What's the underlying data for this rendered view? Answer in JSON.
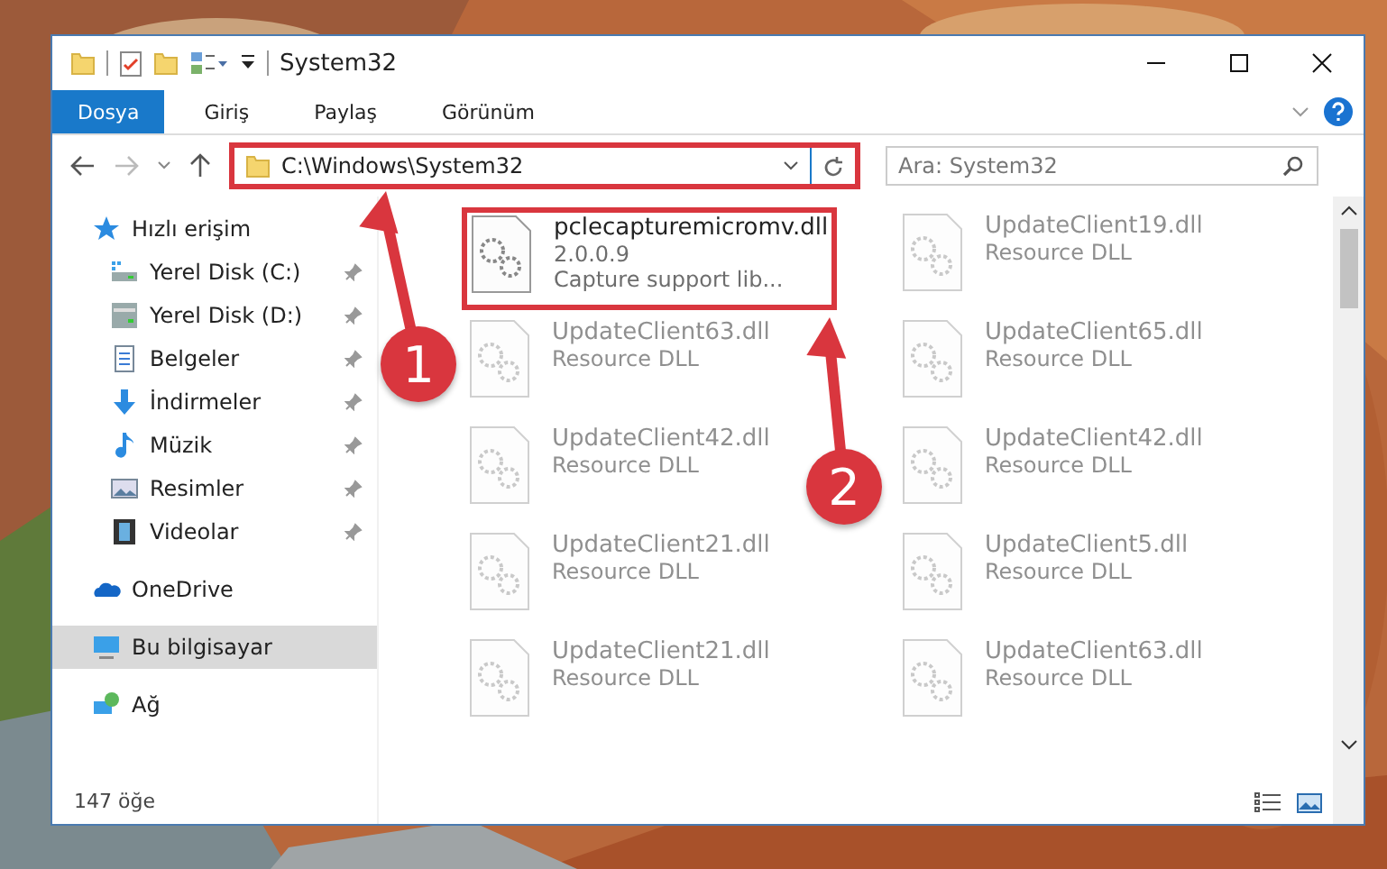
{
  "window": {
    "title": "System32"
  },
  "tabs": [
    {
      "label": "Dosya",
      "selected": true
    },
    {
      "label": "Giriş",
      "selected": false
    },
    {
      "label": "Paylaş",
      "selected": false
    },
    {
      "label": "Görünüm",
      "selected": false
    }
  ],
  "address_bar": {
    "path": "C:\\Windows\\System32",
    "highlighted": true
  },
  "search": {
    "placeholder": "Ara: System32"
  },
  "sidebar": {
    "items": [
      {
        "label": "Hızlı erişim",
        "kind": "star",
        "selected": false,
        "children": [
          {
            "label": "Yerel Disk (C:)",
            "kind": "drive-c",
            "selected": false,
            "pinned": true
          },
          {
            "label": "Yerel Disk (D:)",
            "kind": "drive",
            "selected": false,
            "pinned": true
          },
          {
            "label": "Belgeler",
            "kind": "docs",
            "selected": false,
            "pinned": true
          },
          {
            "label": "İndirmeler",
            "kind": "download",
            "selected": false,
            "pinned": true
          },
          {
            "label": "Müzik",
            "kind": "music",
            "selected": false,
            "pinned": true
          },
          {
            "label": "Resimler",
            "kind": "pictures",
            "selected": false,
            "pinned": true
          },
          {
            "label": "Videolar",
            "kind": "video",
            "selected": false,
            "pinned": true
          }
        ]
      },
      {
        "label": "OneDrive",
        "kind": "cloud",
        "selected": false
      },
      {
        "label": "Bu bilgisayar",
        "kind": "pc",
        "selected": true
      },
      {
        "label": "Ağ",
        "kind": "network",
        "selected": false
      }
    ]
  },
  "files": [
    {
      "name": "pclecapturemicromv.dll",
      "lines": [
        "2.0.0.9",
        "Capture support lib..."
      ],
      "highlighted": true,
      "faded": false
    },
    {
      "name": "UpdateClient19.dll",
      "lines": [
        "Resource DLL"
      ],
      "highlighted": false,
      "faded": true
    },
    {
      "name": "UpdateClient63.dll",
      "lines": [
        "Resource DLL"
      ],
      "highlighted": false,
      "faded": true
    },
    {
      "name": "UpdateClient65.dll",
      "lines": [
        "Resource DLL"
      ],
      "highlighted": false,
      "faded": true
    },
    {
      "name": "UpdateClient42.dll",
      "lines": [
        "Resource DLL"
      ],
      "highlighted": false,
      "faded": true
    },
    {
      "name": "UpdateClient42.dll",
      "lines": [
        "Resource DLL"
      ],
      "highlighted": false,
      "faded": true
    },
    {
      "name": "UpdateClient21.dll",
      "lines": [
        "Resource DLL"
      ],
      "highlighted": false,
      "faded": true
    },
    {
      "name": "UpdateClient5.dll",
      "lines": [
        "Resource DLL"
      ],
      "highlighted": false,
      "faded": true
    },
    {
      "name": "UpdateClient21.dll",
      "lines": [
        "Resource DLL"
      ],
      "highlighted": false,
      "faded": true
    },
    {
      "name": "UpdateClient63.dll",
      "lines": [
        "Resource DLL"
      ],
      "highlighted": false,
      "faded": true
    }
  ],
  "status_bar": {
    "item_count": "147 öğe"
  },
  "callouts": [
    {
      "label": "1"
    },
    {
      "label": "2"
    }
  ]
}
